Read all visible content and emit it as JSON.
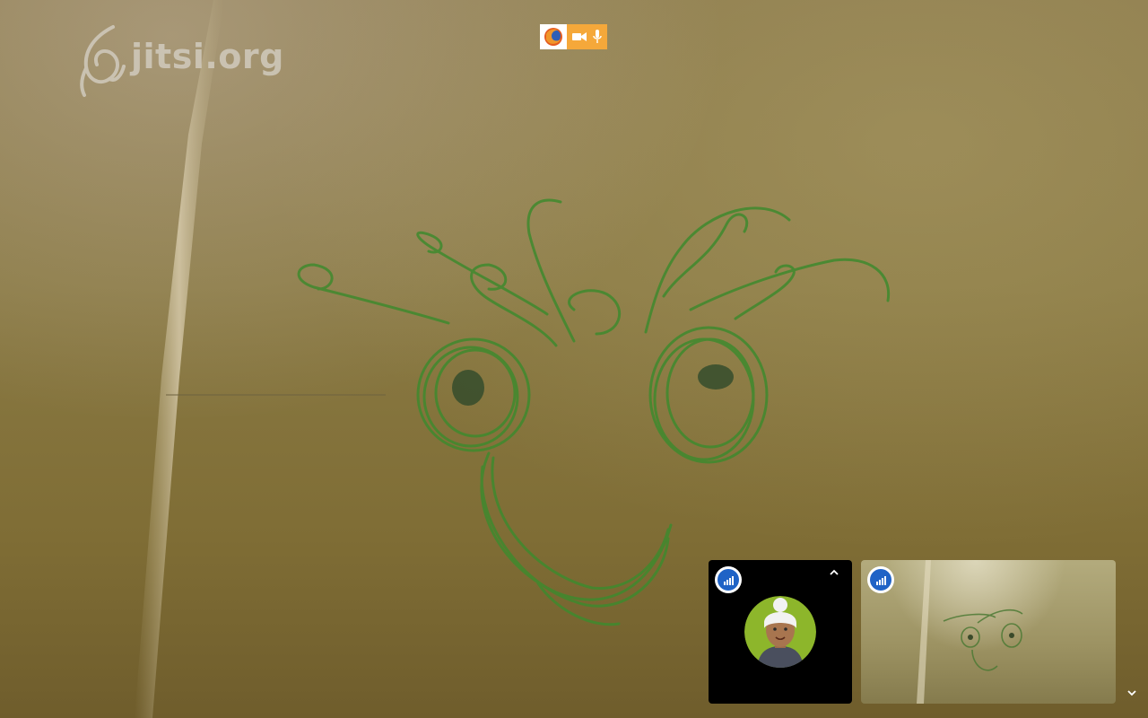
{
  "watermark": {
    "text": "jitsi.org"
  },
  "notifications": {
    "browser_icon": "firefox-icon",
    "camera_icon": "camera-icon",
    "mic_icon": "microphone-icon",
    "badge_color": "#f5a83a"
  },
  "filmstrip": {
    "local": {
      "signal_icon": "connection-quality-icon",
      "menu_icon": "chevron-up-icon",
      "avatar_icon": "avatar-icon",
      "avatar_color": "#8db62b"
    },
    "remote": {
      "signal_icon": "connection-quality-icon"
    },
    "toggle_icon": "chevron-down-icon",
    "signal_color": "#1f63c6"
  }
}
